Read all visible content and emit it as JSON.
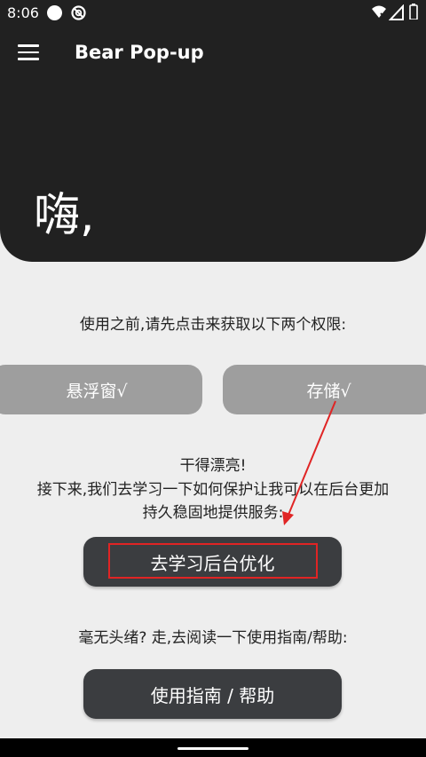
{
  "status_bar": {
    "time": "8:06",
    "icons": [
      "circle-icon",
      "blocked-icon",
      "wifi-off-icon",
      "signal-icon",
      "battery-icon"
    ]
  },
  "header": {
    "menu_icon": "menu-icon",
    "app_title": "Bear Pop-up",
    "greeting": "嗨,"
  },
  "main": {
    "intro_text": "使用之前,请先点击来获取以下两个权限:",
    "permissions": [
      {
        "label": "悬浮窗√"
      },
      {
        "label": "存储√"
      }
    ],
    "praise": "干得漂亮!",
    "next_text_line1": "接下来,我们去学习一下如何保护让我可以在后台更加",
    "next_text_line2": "持久稳固地提供服务:",
    "learn_button": "去学习后台优化",
    "clueless_text": "毫无头绪? 走,去阅读一下使用指南/帮助:",
    "guide_button": "使用指南 / 帮助"
  },
  "colors": {
    "header_bg": "#212121",
    "page_bg": "#eeeeee",
    "permission_button_bg": "#9e9e9e",
    "dark_button_bg": "#3b3d40",
    "annotation_red": "#e02424"
  }
}
